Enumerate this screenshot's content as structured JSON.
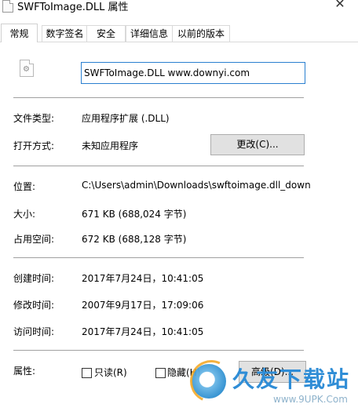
{
  "window": {
    "title": "SWFToImage.DLL 属性",
    "close_glyph": "✕"
  },
  "tabs": [
    {
      "label": "常规",
      "active": true
    },
    {
      "label": "数字签名",
      "active": false
    },
    {
      "label": "安全",
      "active": false
    },
    {
      "label": "详细信息",
      "active": false
    },
    {
      "label": "以前的版本",
      "active": false
    }
  ],
  "general": {
    "file_name": "SWFToImage.DLL www.downyi.com",
    "file_type_label": "文件类型:",
    "file_type_value": "应用程序扩展 (.DLL)",
    "open_with_label": "打开方式:",
    "open_with_value": "未知应用程序",
    "change_button": "更改(C)...",
    "location_label": "位置:",
    "location_value": "C:\\Users\\admin\\Downloads\\swftoimage.dll_down",
    "size_label": "大小:",
    "size_value": "671 KB (688,024 字节)",
    "size_on_disk_label": "占用空间:",
    "size_on_disk_value": "672 KB (688,128 字节)",
    "created_label": "创建时间:",
    "created_value": "2017年7月24日，10:41:05",
    "modified_label": "修改时间:",
    "modified_value": "2007年9月17日，17:09:06",
    "accessed_label": "访问时间:",
    "accessed_value": "2017年7月24日，10:41:05",
    "attributes_label": "属性:",
    "readonly_label": "只读(R)",
    "readonly_checked": false,
    "hidden_label": "隐藏(H)",
    "hidden_checked": false,
    "advanced_button": "高级(D)..."
  },
  "watermark": {
    "text": "久友下载站",
    "url": "www.9UPK.Com"
  },
  "colors": {
    "input_border": "#2a7fd0",
    "button_bg": "#e1e1e1",
    "watermark_blue": "#2f8dd6",
    "watermark_orange": "#f3a51e"
  }
}
